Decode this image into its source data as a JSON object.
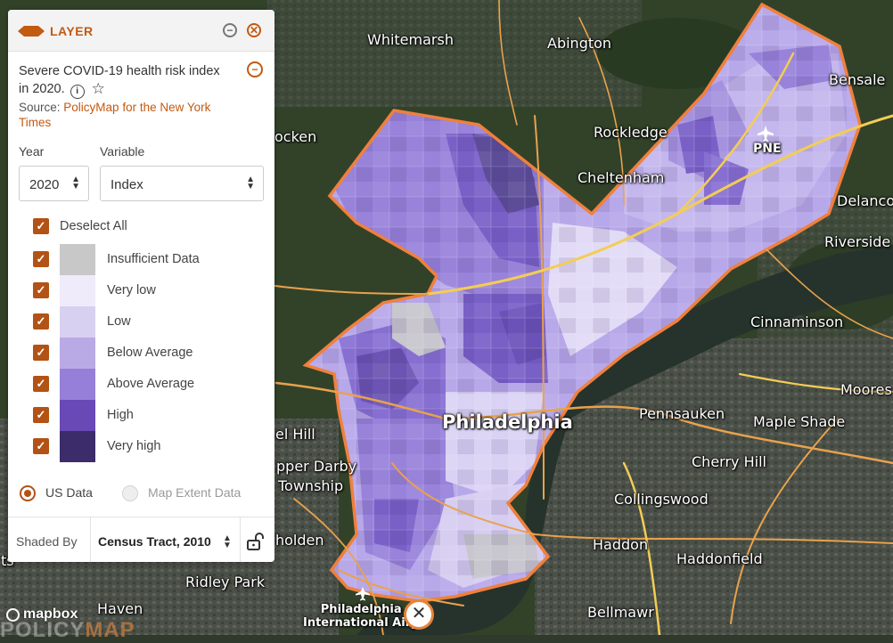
{
  "panel": {
    "header_title": "LAYER",
    "layer_title": "Severe COVID-19 health risk index in 2020.",
    "source_prefix": "Source:",
    "source_link": "PolicyMap for the New York Times",
    "year_label": "Year",
    "year_value": "2020",
    "variable_label": "Variable",
    "variable_value": "Index",
    "deselect_all": "Deselect All",
    "legend": [
      {
        "label": "Insufficient Data",
        "color": "#c8c8c8"
      },
      {
        "label": "Very low",
        "color": "#efebfa"
      },
      {
        "label": "Low",
        "color": "#d8d0f1"
      },
      {
        "label": "Below Average",
        "color": "#b9aae6"
      },
      {
        "label": "Above Average",
        "color": "#957fd8"
      },
      {
        "label": "High",
        "color": "#6849b6"
      },
      {
        "label": "Very high",
        "color": "#3c2c69"
      }
    ],
    "radio_us": "US Data",
    "radio_extent": "Map Extent Data",
    "shaded_by_label": "Shaded By",
    "shaded_by_value": "Census Tract, 2010"
  },
  "map": {
    "places": {
      "whitemarsh": "Whitemarsh",
      "abington": "Abington",
      "bensalem": "Bensale",
      "rockledge": "Rockledge",
      "pne": "PNE",
      "cheltenham": "Cheltenham",
      "conshohocken": "ocken",
      "delanco": "Delanco",
      "riverside": "Riverside",
      "cinnaminson": "Cinnaminson",
      "moorestown": "Moores",
      "pennsauken": "Pennsauken",
      "maple_shade": "Maple Shade",
      "philadelphia": "Philadelphia",
      "hill": "el Hill",
      "cherry_hill": "Cherry Hill",
      "upper_darby": "pper Darby",
      "township": "Township",
      "collingswood": "Collingswood",
      "holden": "holden",
      "haddon": "Haddon",
      "haddonfield": "Haddonfield",
      "ts": "ts",
      "ridley_park": "Ridley Park",
      "haven": "Haven",
      "airport_1": "Philadelphia",
      "airport_2": "International Airp",
      "bellmawr": "Bellmawr"
    },
    "colors": {
      "boundary": "#f0803c",
      "road": "#e9a24c",
      "highway": "#f3cd55"
    }
  },
  "branding": {
    "mapbox": "mapbox",
    "policymap_a": "POLICY",
    "policymap_b": "MAP"
  }
}
